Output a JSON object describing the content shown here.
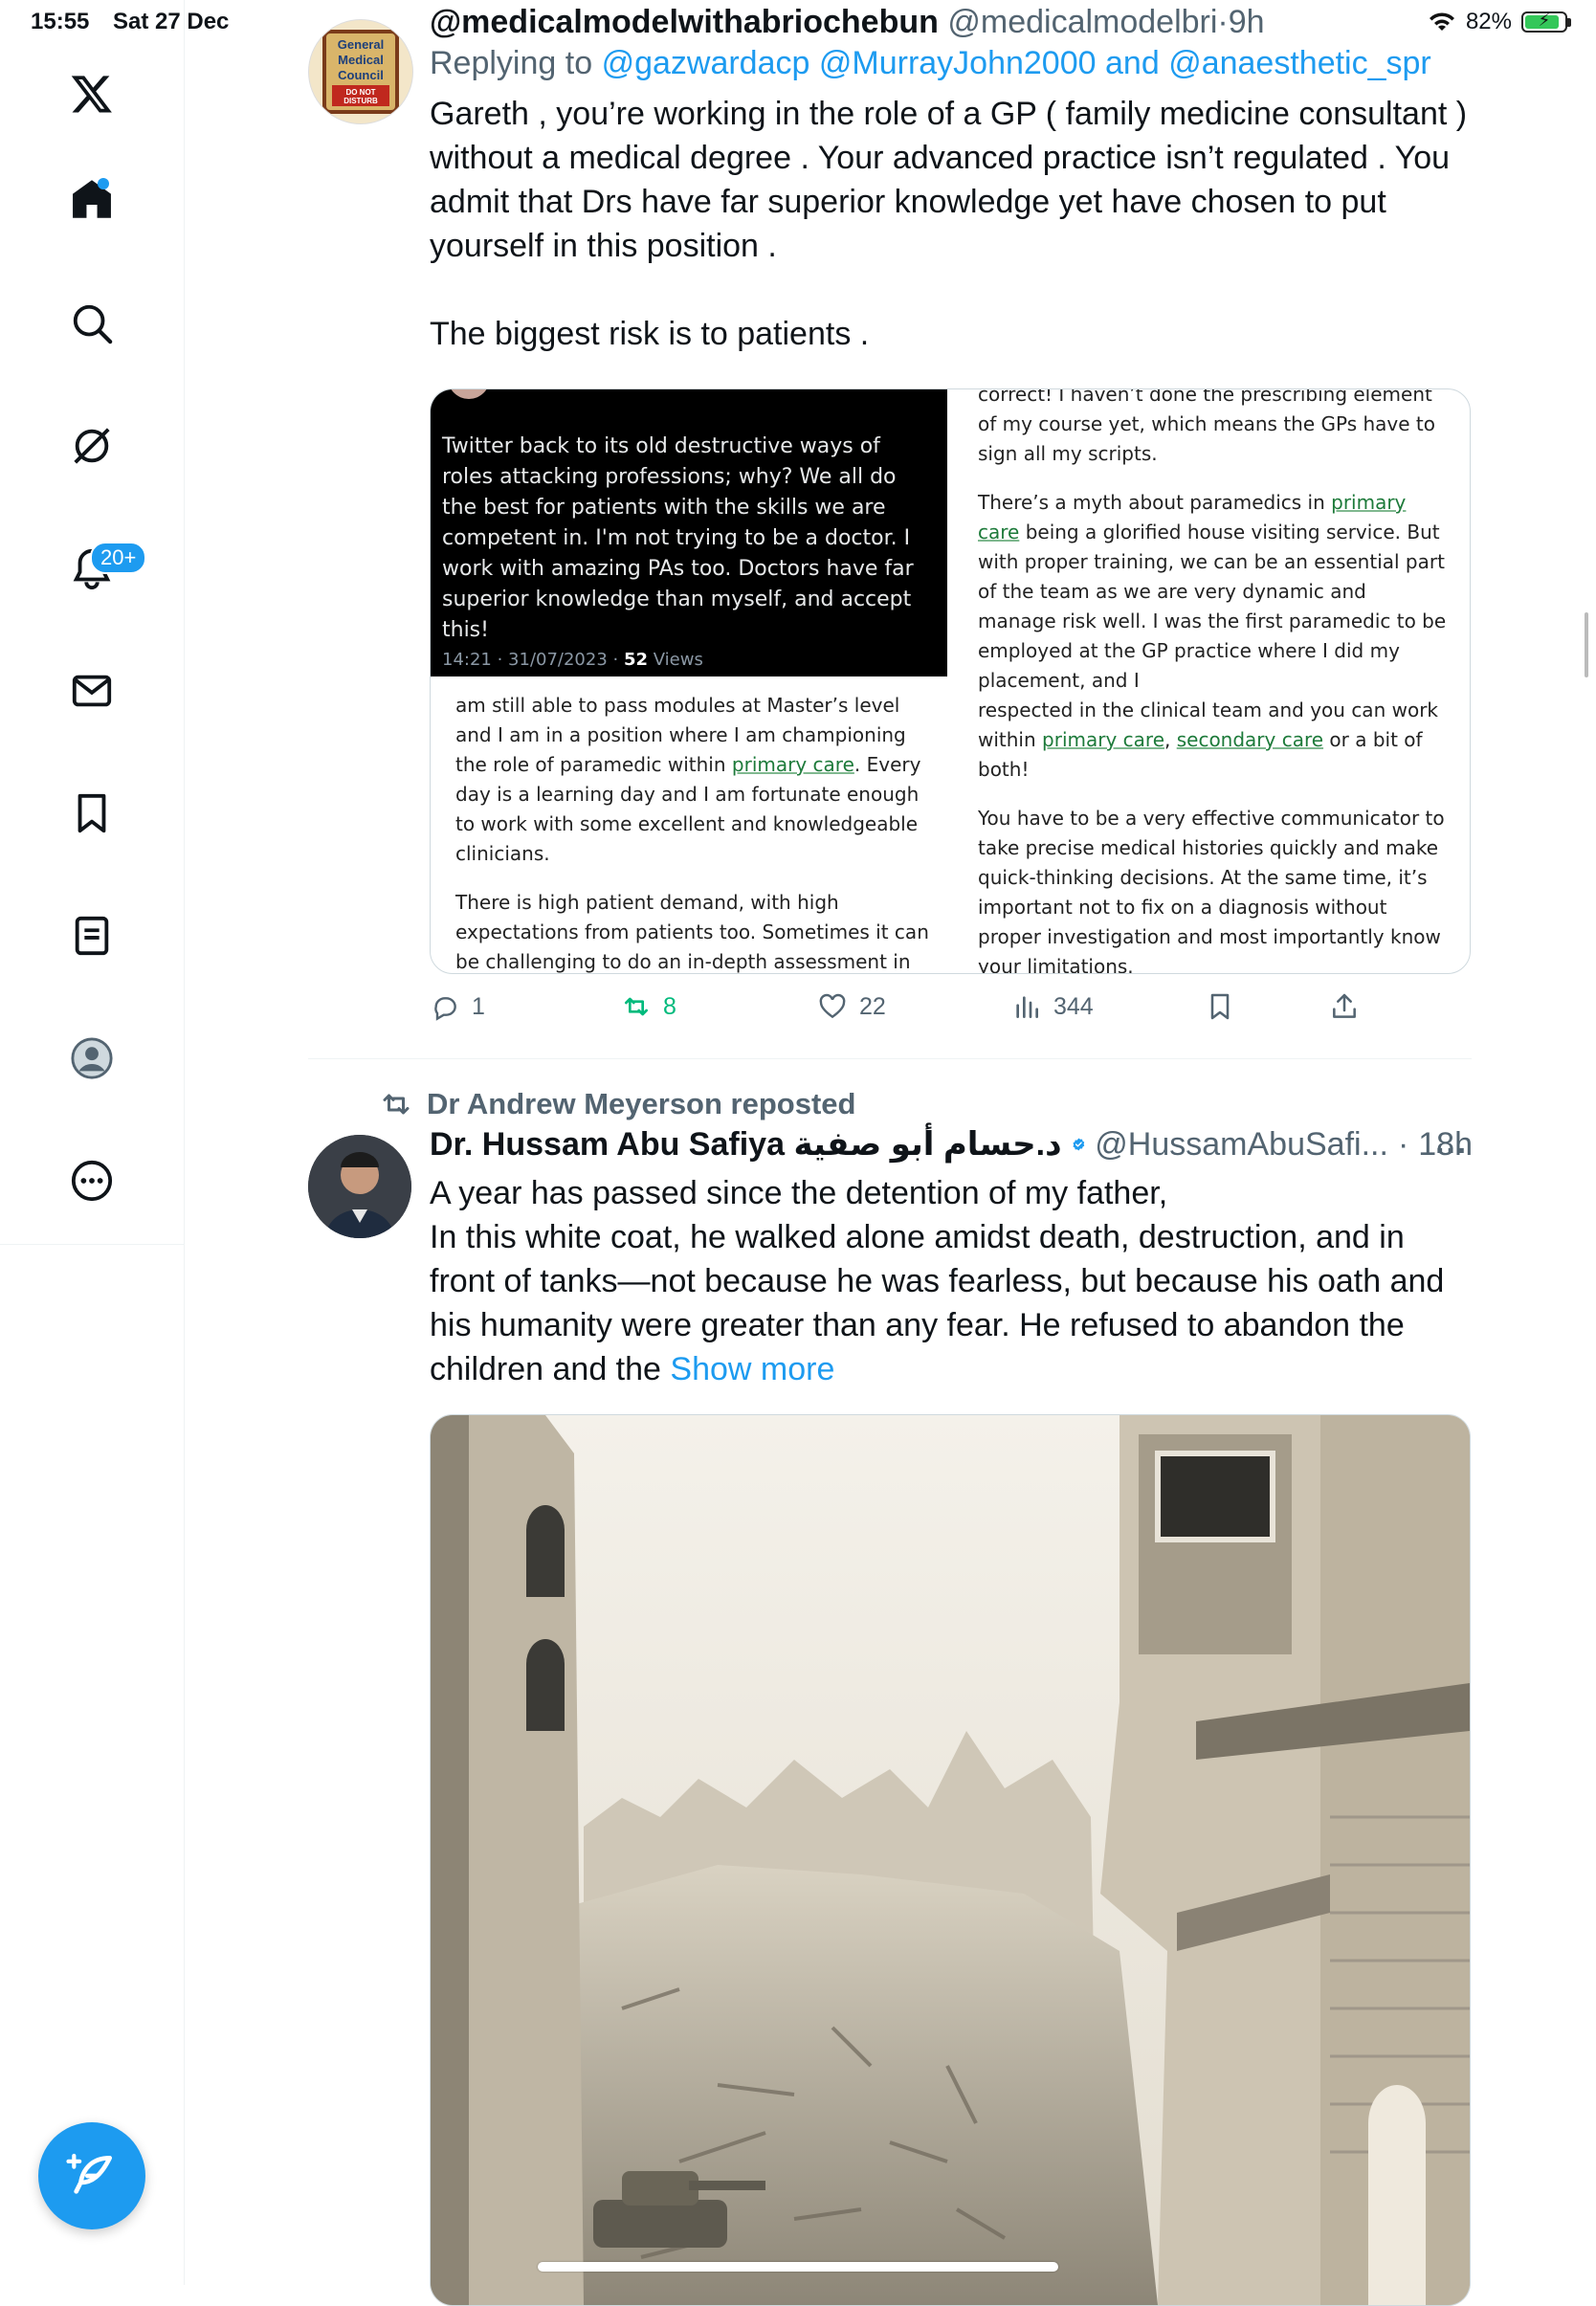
{
  "status_bar": {
    "time": "15:55",
    "date": "Sat 27 Dec",
    "battery": "82%"
  },
  "sidebar": {
    "notifications_badge": "20+"
  },
  "tweet1": {
    "display_name": "@medicalmodelwithabriochebun",
    "handle": "@medicalmodelbri",
    "time": "9h",
    "replying_to_label": "Replying to",
    "mention1": "@gazwardacp",
    "mention2": "@MurrayJohn2000",
    "and_label": "and",
    "mention3": "@anaesthetic_spr",
    "body_p1": "Gareth , you’re working in the role of a GP ( family medicine consultant ) without a medical degree . Your advanced practice isn’t regulated . You admit that Drs have far superior knowledge yet have chosen to put yourself in this position .",
    "body_p2": "The biggest risk is to patients .",
    "avatar_text": [
      "General",
      "Medical",
      "Council",
      "DO NOT",
      "DISTURB"
    ],
    "embedded": {
      "dark_tweet_text": "Twitter back to its old destructive ways of roles attacking professions; why? We all do the best for patients with the skills we are competent in. I'm not trying to be a doctor. I work with amazing PAs too. Doctors have far superior knowledge than myself, and accept this!",
      "dark_tweet_time": "14:21 · 31/07/2023 ·",
      "dark_tweet_views_num": "52",
      "dark_tweet_views_label": "Views",
      "left_p1_a": "am still able to pass modules at Master’s level and I am in a position where I am championing the role of paramedic within ",
      "left_p1_link": "primary care",
      "left_p1_b": ". Every day is a learning day and I am fortunate enough to work with some excellent and knowledgeable clinicians.",
      "left_p2": "There is high patient demand, with high expectations from patients too. Sometimes it can be challenging to do an in-depth assessment in",
      "right_p0": "correct! I haven’t done the prescribing element of my course yet, which means the GPs have to sign all my scripts.",
      "right_p1_a": "There’s a myth about paramedics in ",
      "right_p1_link": "primary care",
      "right_p1_b": " being a glorified house visiting service. But with proper training, we can be an essential part of the team as we are very dynamic and manage risk well. I was the first paramedic to be employed at the GP practice where I did my placement, and I",
      "right_p1_c": "respected in the clinical team and you can work within ",
      "right_p1_link2": "primary care",
      "right_p1_sep": ", ",
      "right_p1_link3": "secondary care",
      "right_p1_d": " or a bit of both!",
      "right_p2": "You have to be a very effective communicator to take precise medical histories quickly and make quick-thinking decisions. At the same time, it’s important not to fix on a diagnosis without proper investigation and most importantly know your limitations."
    },
    "actions": {
      "replies": "1",
      "reposts": "8",
      "likes": "22",
      "views": "344"
    }
  },
  "tweet2": {
    "repost_label": "Dr Andrew Meyerson reposted",
    "display_name": "Dr. Hussam Abu Safiya د.حسام أبو صفية",
    "handle": "@HussamAbuSafi...",
    "time": "18h",
    "more_glyph": "···",
    "body": "A year has passed since the detention of my father,\nIn this white coat, he walked alone amidst death, destruction, and in front of tanks—not because he was fearless, but because his oath and his humanity were greater than any fear. He refused to abandon the children and the ",
    "show_more": "Show more"
  },
  "colors": {
    "accent": "#1d9bf0",
    "repost_green": "#00ba7c",
    "muted": "#536471"
  }
}
